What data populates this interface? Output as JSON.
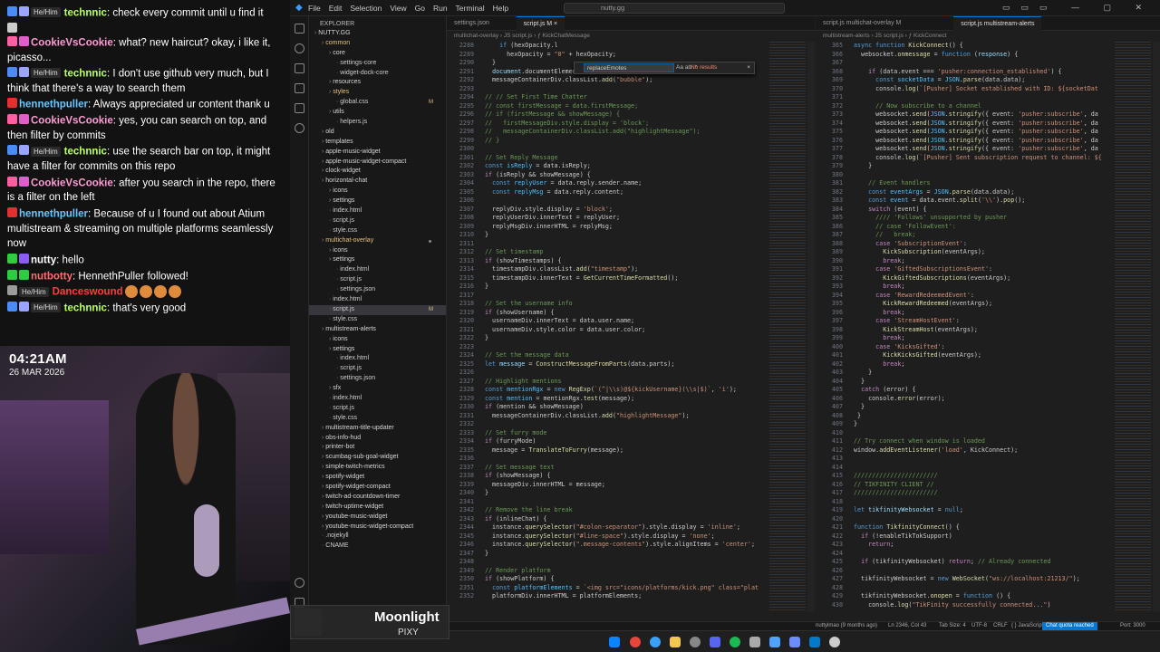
{
  "chat": {
    "messages": [
      {
        "pron": "He/Him",
        "user": "technnic",
        "color": "#b8ff5a",
        "text": ": check every commit until u find it",
        "badges": [
          "#4c8bf5",
          "#9aa4ff"
        ]
      },
      {
        "pron": "",
        "user": "",
        "color": "#ffffff",
        "text": "",
        "badges": [
          "#cccccc"
        ]
      },
      {
        "pron": "",
        "user": "CookieVsCookie",
        "color": "#ff9ad5",
        "text": ": what? new haircut? okay, i like it, picasso...",
        "badges": [
          "#ff5fa2",
          "#e05ecb"
        ]
      },
      {
        "pron": "He/Him",
        "user": "technnic",
        "color": "#b8ff5a",
        "text": ": I don't use github very much, but I think that there's a way to search them",
        "badges": [
          "#4c8bf5",
          "#9aa4ff"
        ]
      },
      {
        "pron": "",
        "user": "hennethpuller",
        "color": "#66c6ff",
        "text": ": Always appreciated ur content thank u",
        "badges": [
          "#e03030"
        ]
      },
      {
        "pron": "",
        "user": "CookieVsCookie",
        "color": "#ff9ad5",
        "text": ": yes, you can search on top, and then filter by commits",
        "badges": [
          "#ff5fa2",
          "#e05ecb"
        ]
      },
      {
        "pron": "He/Him",
        "user": "technnic",
        "color": "#b8ff5a",
        "text": ": use the search bar on top, it might have a filter for commits on this repo",
        "badges": [
          "#4c8bf5",
          "#9aa4ff"
        ]
      },
      {
        "pron": "",
        "user": "CookieVsCookie",
        "color": "#ff9ad5",
        "text": ": after you search in the repo, there is a filter on the left",
        "badges": [
          "#ff5fa2",
          "#e05ecb"
        ]
      },
      {
        "pron": "",
        "user": "hennethpuller",
        "color": "#66c6ff",
        "text": ": Because of u I found out about Atium multistream & streaming on multiple platforms seamlessly now",
        "badges": [
          "#e03030"
        ]
      },
      {
        "pron": "",
        "user": "nutty",
        "color": "#ffffff",
        "text": ": hello",
        "badges": [
          "#2ecc40",
          "#8b5cf6"
        ]
      },
      {
        "pron": "",
        "user": "nutbotty",
        "color": "#ff6b6b",
        "text": ": HennethPuller followed!",
        "badges": [
          "#2ecc40",
          "#2ecc40"
        ]
      },
      {
        "pron": "He/Him",
        "user": "Danceswound",
        "color": "#ff3b3b",
        "text": "",
        "badges": [
          "#9b9b9b"
        ],
        "emotes": 4
      },
      {
        "pron": "He/Him",
        "user": "technnic",
        "color": "#b8ff5a",
        "text": ": that's very good",
        "badges": [
          "#4c8bf5",
          "#9aa4ff"
        ]
      }
    ]
  },
  "clock": {
    "time": "04:21AM",
    "date": "26 MAR 2026"
  },
  "editor": {
    "menu": [
      "File",
      "Edit",
      "Selection",
      "View",
      "Go",
      "Run",
      "Terminal",
      "Help"
    ],
    "command_center": "nutty.gg",
    "explorer_title": "EXPLORER",
    "tree": [
      {
        "name": "NUTTY.GG",
        "depth": 0,
        "folder": true
      },
      {
        "name": "common",
        "depth": 1,
        "folder": true,
        "style": true
      },
      {
        "name": "core",
        "depth": 2,
        "folder": true
      },
      {
        "name": "settings-core",
        "depth": 3
      },
      {
        "name": "widget-dock-core",
        "depth": 3
      },
      {
        "name": "resources",
        "depth": 2,
        "folder": true
      },
      {
        "name": "styles",
        "depth": 2,
        "folder": true,
        "style": true
      },
      {
        "name": "global.css",
        "depth": 3,
        "mod": "M"
      },
      {
        "name": "utils",
        "depth": 2,
        "folder": true
      },
      {
        "name": "helpers.js",
        "depth": 3
      },
      {
        "name": "old",
        "depth": 1,
        "folder": true
      },
      {
        "name": "templates",
        "depth": 1,
        "folder": true
      },
      {
        "name": "apple-music-widget",
        "depth": 1,
        "folder": true
      },
      {
        "name": "apple-music-widget-compact",
        "depth": 1,
        "folder": true
      },
      {
        "name": "clock-widget",
        "depth": 1,
        "folder": true
      },
      {
        "name": "horizontal-chat",
        "depth": 1,
        "folder": true
      },
      {
        "name": "icons",
        "depth": 2,
        "folder": true
      },
      {
        "name": "settings",
        "depth": 2,
        "folder": true
      },
      {
        "name": "index.html",
        "depth": 2
      },
      {
        "name": "script.js",
        "depth": 2
      },
      {
        "name": "style.css",
        "depth": 2
      },
      {
        "name": "multichat-overlay",
        "depth": 1,
        "folder": true,
        "style": true,
        "dot": true
      },
      {
        "name": "icons",
        "depth": 2,
        "folder": true
      },
      {
        "name": "settings",
        "depth": 2,
        "folder": true
      },
      {
        "name": "index.html",
        "depth": 3
      },
      {
        "name": "script.js",
        "depth": 3
      },
      {
        "name": "settings.json",
        "depth": 3
      },
      {
        "name": "index.html",
        "depth": 2
      },
      {
        "name": "script.js",
        "depth": 2,
        "mod": "M",
        "sel": true
      },
      {
        "name": "style.css",
        "depth": 2
      },
      {
        "name": "multistream-alerts",
        "depth": 1,
        "folder": true
      },
      {
        "name": "icons",
        "depth": 2,
        "folder": true
      },
      {
        "name": "settings",
        "depth": 2,
        "folder": true
      },
      {
        "name": "index.html",
        "depth": 3
      },
      {
        "name": "script.js",
        "depth": 3
      },
      {
        "name": "settings.json",
        "depth": 3
      },
      {
        "name": "sfx",
        "depth": 2,
        "folder": true
      },
      {
        "name": "index.html",
        "depth": 2
      },
      {
        "name": "script.js",
        "depth": 2
      },
      {
        "name": "style.css",
        "depth": 2
      },
      {
        "name": "multistream-title-updater",
        "depth": 1,
        "folder": true
      },
      {
        "name": "obs-info-hud",
        "depth": 1,
        "folder": true
      },
      {
        "name": "printer-bot",
        "depth": 1,
        "folder": true
      },
      {
        "name": "scumbag-sub-goal-widget",
        "depth": 1,
        "folder": true
      },
      {
        "name": "simple-twitch-metrics",
        "depth": 1,
        "folder": true
      },
      {
        "name": "spotify-widget",
        "depth": 1,
        "folder": true
      },
      {
        "name": "spotify-widget-compact",
        "depth": 1,
        "folder": true
      },
      {
        "name": "twitch-ad-countdown-timer",
        "depth": 1,
        "folder": true
      },
      {
        "name": "twitch-uptime-widget",
        "depth": 1,
        "folder": true
      },
      {
        "name": "youtube-music-widget",
        "depth": 1,
        "folder": true
      },
      {
        "name": "youtube-music-widget-compact",
        "depth": 1,
        "folder": true
      },
      {
        "name": ".nojekyll",
        "depth": 1
      },
      {
        "name": "CNAME",
        "depth": 1
      }
    ],
    "left_pane": {
      "tabs": [
        {
          "label": "settings.json"
        },
        {
          "label": "script.js  M  ×",
          "active": true
        }
      ],
      "crumb": "multichat-overlay  ›  JS script.js  ›  ƒ KickChatMessage",
      "find": {
        "value": "replaceEmotes",
        "ops": "Aa  ab  .*",
        "result": "No results",
        "close": "×"
      }
    },
    "right_pane": {
      "tabs": [
        {
          "label": "script.js  multichat-overlay  M"
        },
        {
          "label": "script.js  multistream-alerts",
          "active": true
        }
      ],
      "crumb": "multistream-alerts  ›  JS script.js  ›  ƒ KickConnect"
    },
    "status": {
      "left": "nuttylmao (9 months ago)",
      "pos": "Ln 2346, Col 43",
      "tab": "Tab Size: 4",
      "enc": "UTF-8",
      "eol": "CRLF",
      "lang": "{ }  JavaScript",
      "quota": "Chat quota reached",
      "port": "Port: 3000"
    }
  },
  "now_playing": {
    "song": "Moonlight",
    "artist": "PIXY"
  }
}
